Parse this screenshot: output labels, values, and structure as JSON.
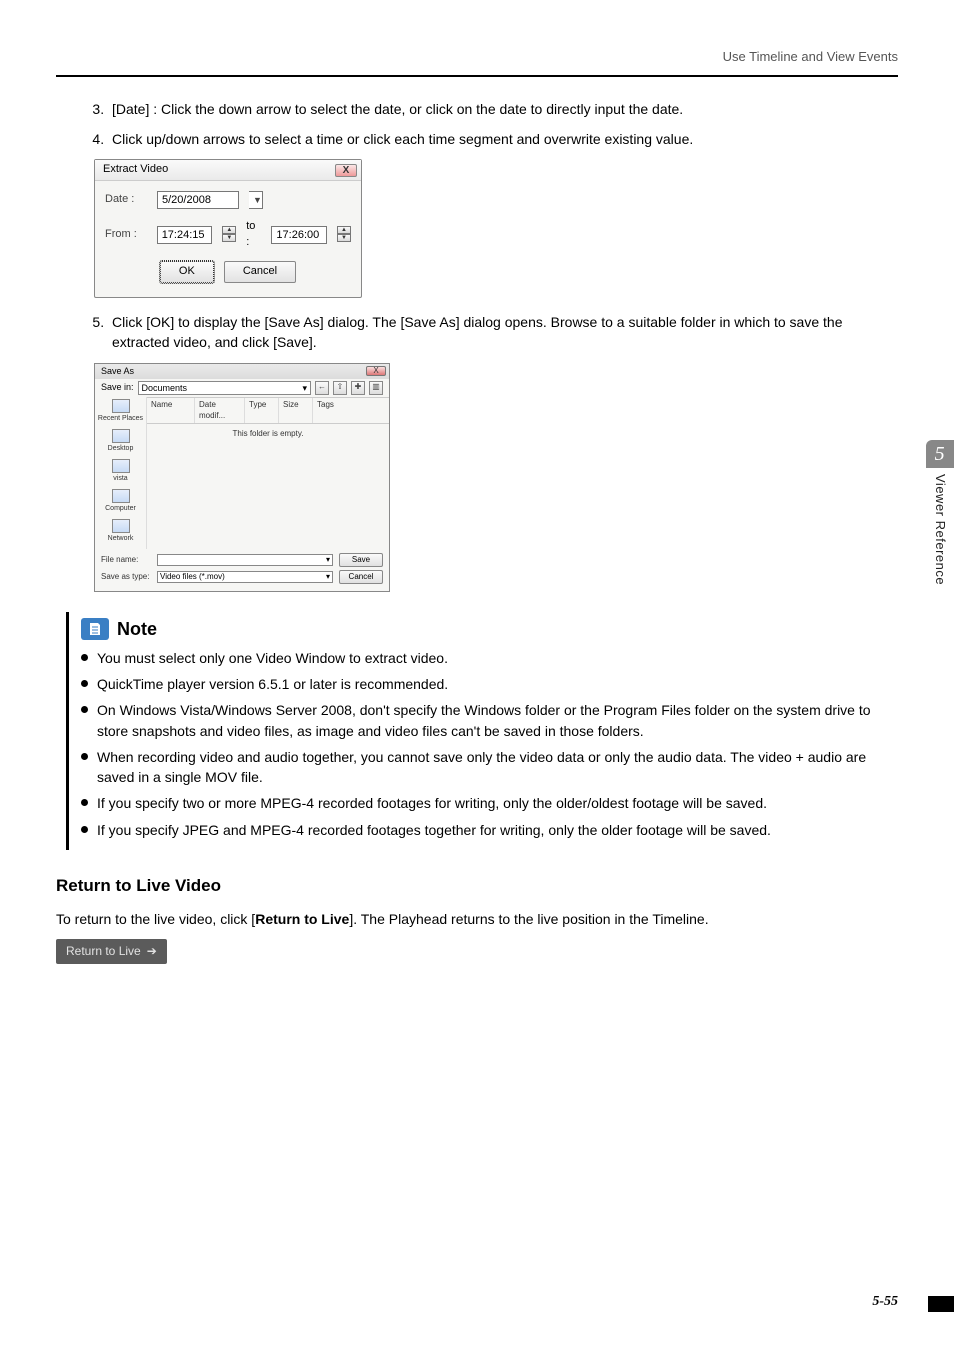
{
  "header": {
    "section_title": "Use Timeline and View Events"
  },
  "steps": {
    "s3": "[Date] : Click the down arrow to select the date, or click on the date to directly input the date.",
    "s4": "Click up/down arrows to select a time or click each time segment and overwrite existing value.",
    "s5": "Click [OK] to display the [Save As] dialog. The [Save As] dialog opens. Browse to a suitable folder in which to save the extracted video, and click [Save]."
  },
  "extract_dialog": {
    "title": "Extract Video",
    "close": "X",
    "date_label": "Date :",
    "date_value": "5/20/2008",
    "from_label": "From :",
    "from_value": "17:24:15",
    "to_label": "to :",
    "to_value": "17:26:00",
    "ok": "OK",
    "cancel": "Cancel"
  },
  "saveas_dialog": {
    "title": "Save As",
    "close": "X",
    "save_in_label": "Save in:",
    "save_in_value": "Documents",
    "columns": {
      "name": "Name",
      "date": "Date modif...",
      "type": "Type",
      "size": "Size",
      "tags": "Tags"
    },
    "empty": "This folder is empty.",
    "places": {
      "recent": "Recent Places",
      "desktop": "Desktop",
      "user": "vista",
      "computer": "Computer",
      "network": "Network"
    },
    "file_name_label": "File name:",
    "file_name_value": "",
    "save_type_label": "Save as type:",
    "save_type_value": "Video files (*.mov)",
    "save": "Save",
    "cancel": "Cancel"
  },
  "note": {
    "title": "Note",
    "items": [
      "You must select only one Video Window to extract video.",
      "QuickTime player version 6.5.1 or later is recommended.",
      "On Windows Vista/Windows Server 2008, don't specify the Windows folder or the Program Files folder on the system drive to store snapshots and video files, as image and video files can't be saved in those folders.",
      "When recording video and audio together, you cannot save only the video data or only the audio data. The video + audio are saved in a single MOV file.",
      "If you specify two or more MPEG-4 recorded footages for writing, only the older/oldest footage will be saved.",
      "If you specify JPEG and MPEG-4 recorded footages together for writing, only the older footage will be saved."
    ]
  },
  "return_section": {
    "heading": "Return to Live Video",
    "body_pre": "To return to the live video, click [",
    "body_bold": "Return to Live",
    "body_post": "]. The Playhead returns to the live position in the Timeline.",
    "button_label": "Return to Live"
  },
  "side": {
    "chapter": "5",
    "label": "Viewer Reference"
  },
  "footer": {
    "page": "5-55"
  }
}
